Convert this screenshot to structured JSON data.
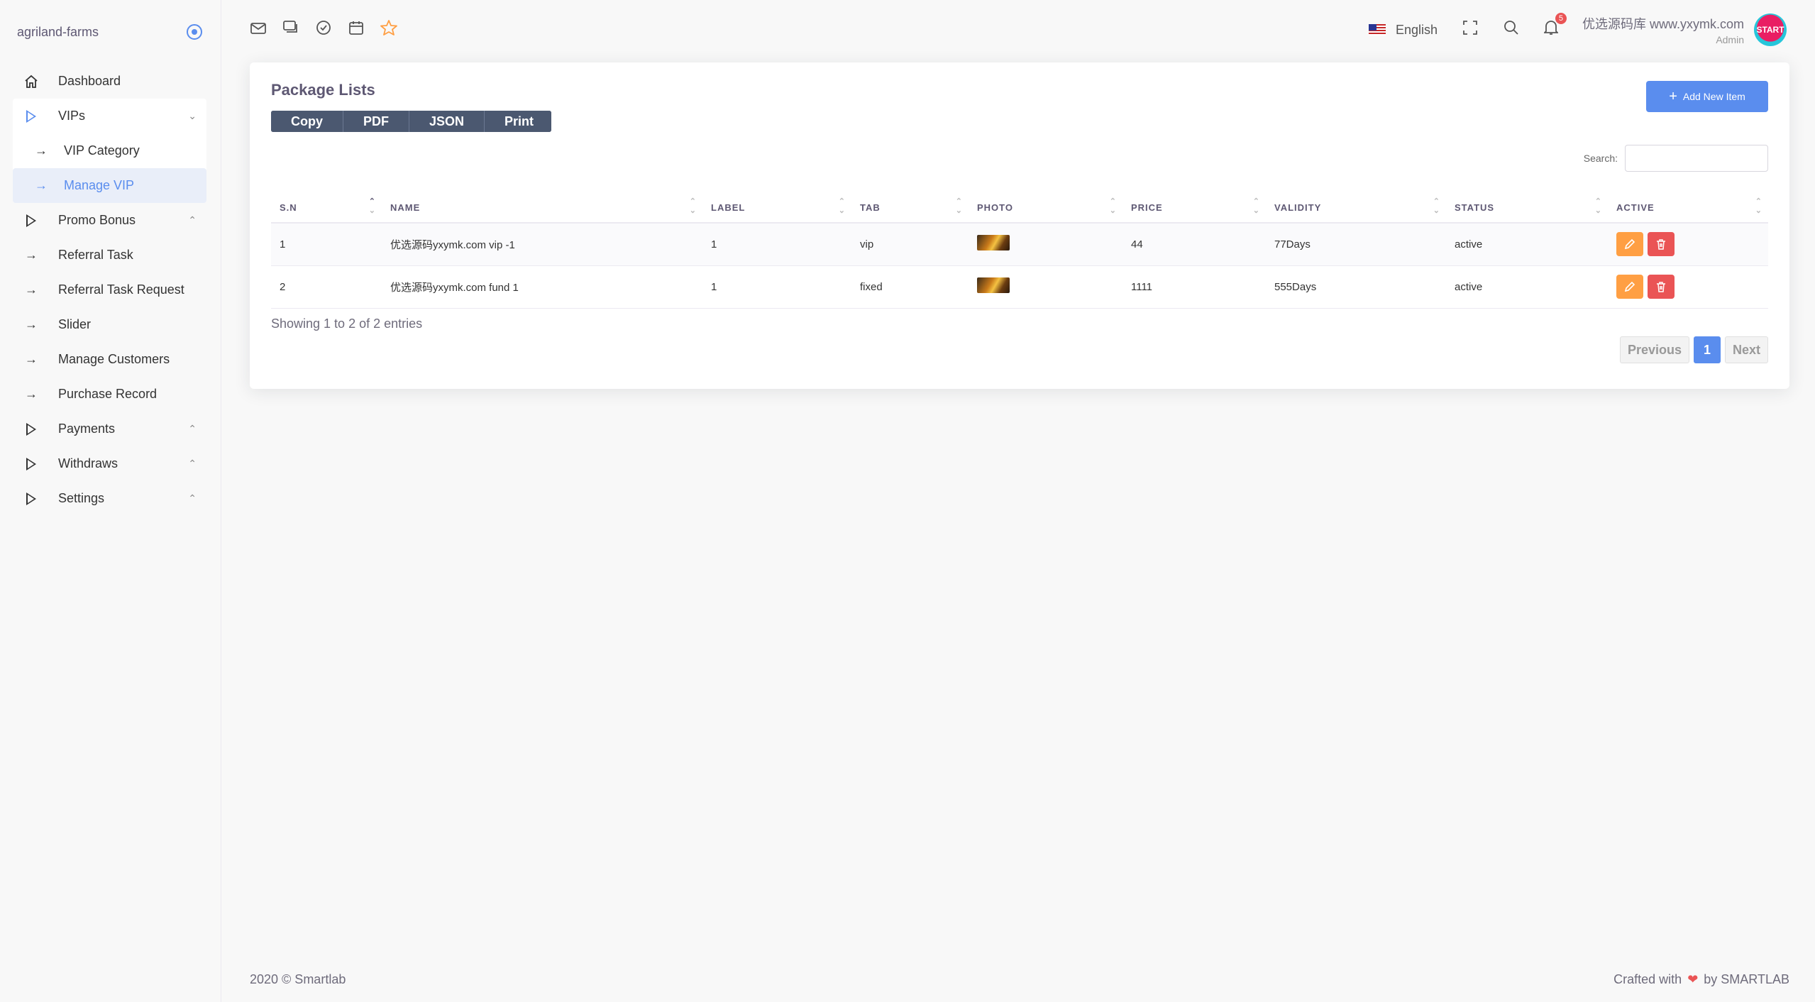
{
  "brand": {
    "name": "agriland-farms"
  },
  "sidebar": {
    "dashboard": "Dashboard",
    "vips": "VIPs",
    "vip_category": "VIP Category",
    "manage_vip": "Manage VIP",
    "promo_bonus": "Promo Bonus",
    "referral_task": "Referral Task",
    "referral_task_request": "Referral Task Request",
    "slider": "Slider",
    "manage_customers": "Manage Customers",
    "purchase_record": "Purchase Record",
    "payments": "Payments",
    "withdraws": "Withdraws",
    "settings": "Settings"
  },
  "topbar": {
    "language": "English",
    "notification_count": "5",
    "user_name": "优选源码库 www.yxymk.com",
    "user_role": "Admin",
    "avatar_text": "START"
  },
  "card": {
    "title": "Package Lists",
    "export_buttons": [
      "Copy",
      "PDF",
      "JSON",
      "Print"
    ],
    "add_button": "Add New Item",
    "search_label": "Search:",
    "search_value": "",
    "columns": [
      "S.N",
      "NAME",
      "LABEL",
      "TAB",
      "PHOTO",
      "PRICE",
      "VALIDITY",
      "STATUS",
      "ACTIVE"
    ],
    "rows": [
      {
        "sn": "1",
        "name": "优选源码yxymk.com vip -1",
        "label": "1",
        "tab": "vip",
        "price": "44",
        "validity": "77Days",
        "status": "active"
      },
      {
        "sn": "2",
        "name": "优选源码yxymk.com fund 1",
        "label": "1",
        "tab": "fixed",
        "price": "1111",
        "validity": "555Days",
        "status": "active"
      }
    ],
    "info": "Showing 1 to 2 of 2 entries",
    "pager": {
      "previous": "Previous",
      "current": "1",
      "next": "Next"
    }
  },
  "footer": {
    "left": "2020 © Smartlab",
    "right_prefix": "Crafted with",
    "right_suffix": "by SMARTLAB"
  },
  "colors": {
    "accent": "#5a8dee",
    "edit": "#ff9f43",
    "delete": "#ea5455",
    "export_bg": "#4b5870"
  }
}
